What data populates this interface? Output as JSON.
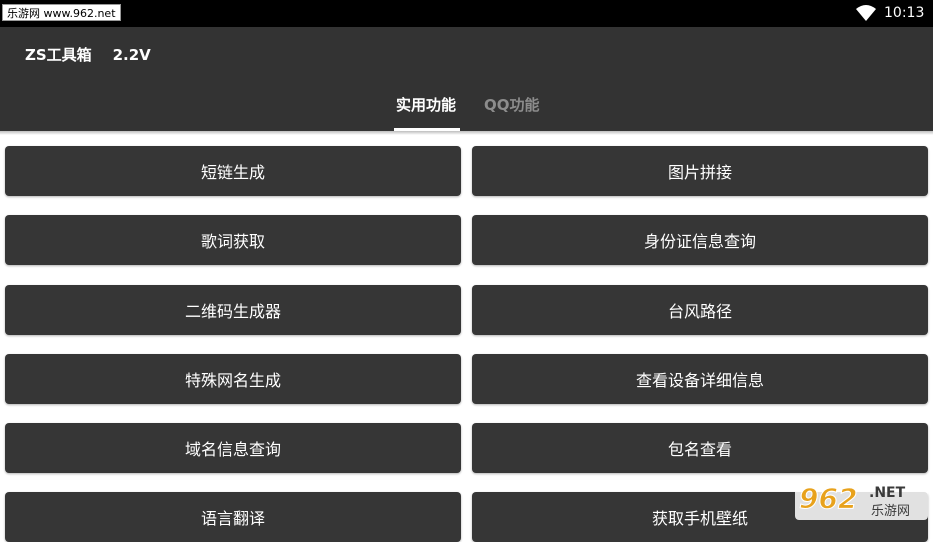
{
  "status_bar": {
    "watermark": "乐游网 www.962.net",
    "time": "10:13"
  },
  "app": {
    "title": "ZS工具箱",
    "version": "2.2V"
  },
  "tabs": [
    {
      "label": "实用功能",
      "active": true
    },
    {
      "label": "QQ功能",
      "active": false
    }
  ],
  "buttons": [
    {
      "label": "短链生成"
    },
    {
      "label": "图片拼接"
    },
    {
      "label": "歌词获取"
    },
    {
      "label": "身份证信息查询"
    },
    {
      "label": "二维码生成器"
    },
    {
      "label": "台风路径"
    },
    {
      "label": "特殊网名生成"
    },
    {
      "label": "查看设备详细信息"
    },
    {
      "label": "域名信息查询"
    },
    {
      "label": "包名查看"
    },
    {
      "label": "语言翻译"
    },
    {
      "label": "获取手机壁纸"
    }
  ],
  "logo": {
    "main": "962",
    "suffix": ".NET",
    "sub": "乐游网"
  },
  "colors": {
    "toolbar": "#333333",
    "button": "#363636",
    "tab_inactive": "#8c8c8c"
  }
}
